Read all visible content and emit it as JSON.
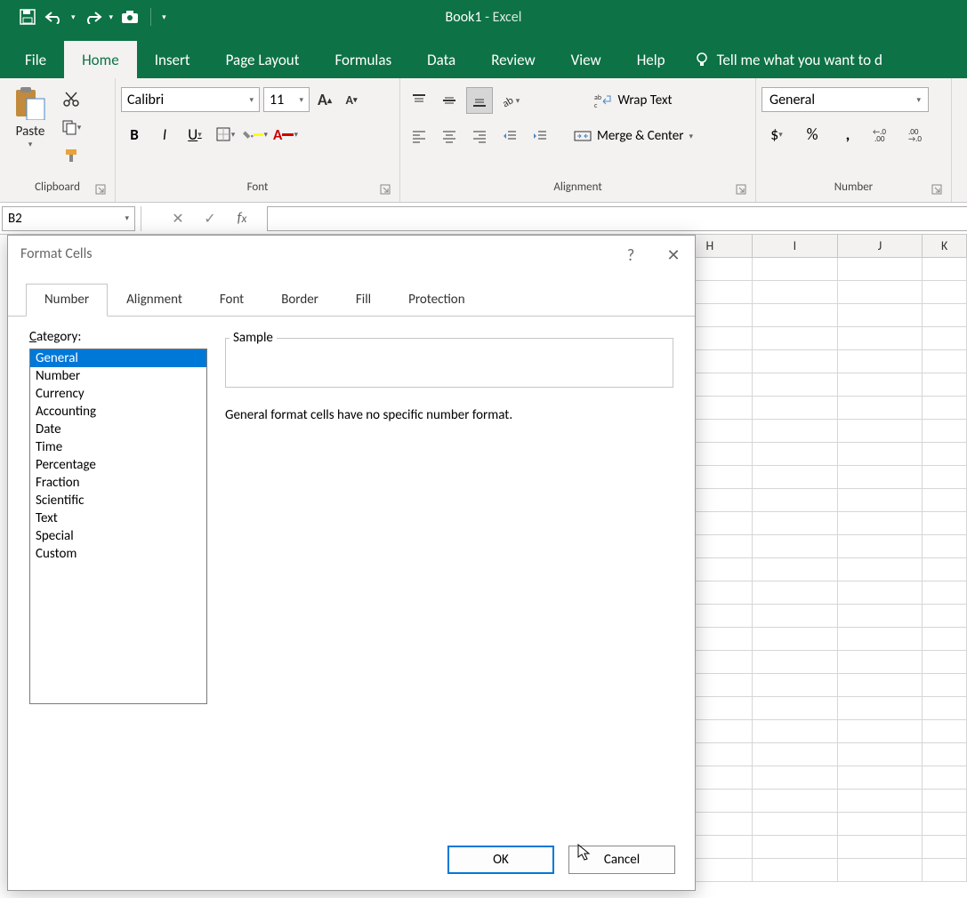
{
  "app": {
    "doc": "Book1",
    "suffix": "  -  Excel"
  },
  "tabs": [
    "File",
    "Home",
    "Insert",
    "Page Layout",
    "Formulas",
    "Data",
    "Review",
    "View",
    "Help"
  ],
  "tell_me": "Tell me what you want to d",
  "clipboard": {
    "paste": "Paste",
    "label": "Clipboard"
  },
  "font": {
    "name": "Calibri",
    "size": "11",
    "label": "Font",
    "bold": "B",
    "italic": "I",
    "underline": "U"
  },
  "alignment": {
    "label": "Alignment",
    "wrap": "Wrap Text",
    "merge": "Merge & Center"
  },
  "number": {
    "format": "General",
    "label": "Number",
    "currency": "$",
    "percent": "%",
    "comma": ","
  },
  "name_box": "B2",
  "columns": [
    "H",
    "I",
    "J",
    "K"
  ],
  "dialog": {
    "title": "Format Cells",
    "tabs": [
      "Number",
      "Alignment",
      "Font",
      "Border",
      "Fill",
      "Protection"
    ],
    "category_label": "Category:",
    "categories": [
      "General",
      "Number",
      "Currency",
      "Accounting",
      "Date",
      "Time",
      "Percentage",
      "Fraction",
      "Scientific",
      "Text",
      "Special",
      "Custom"
    ],
    "sample_label": "Sample",
    "description": "General format cells have no specific number format.",
    "ok": "OK",
    "cancel": "Cancel"
  }
}
